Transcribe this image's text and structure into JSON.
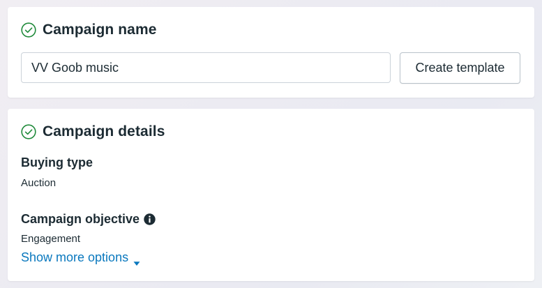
{
  "campaign_name_section": {
    "title": "Campaign name",
    "icon": "check-circle-icon",
    "input_value": "VV Goob music",
    "create_template_label": "Create template"
  },
  "campaign_details_section": {
    "title": "Campaign details",
    "icon": "check-circle-icon",
    "buying_type_label": "Buying type",
    "buying_type_value": "Auction",
    "objective_label": "Campaign objective",
    "objective_info_icon": "info-icon",
    "objective_value": "Engagement",
    "show_more_label": "Show more options"
  },
  "colors": {
    "check_green": "#1f8a3a",
    "link_blue": "#0a78be",
    "text_dark": "#1c2b33"
  }
}
